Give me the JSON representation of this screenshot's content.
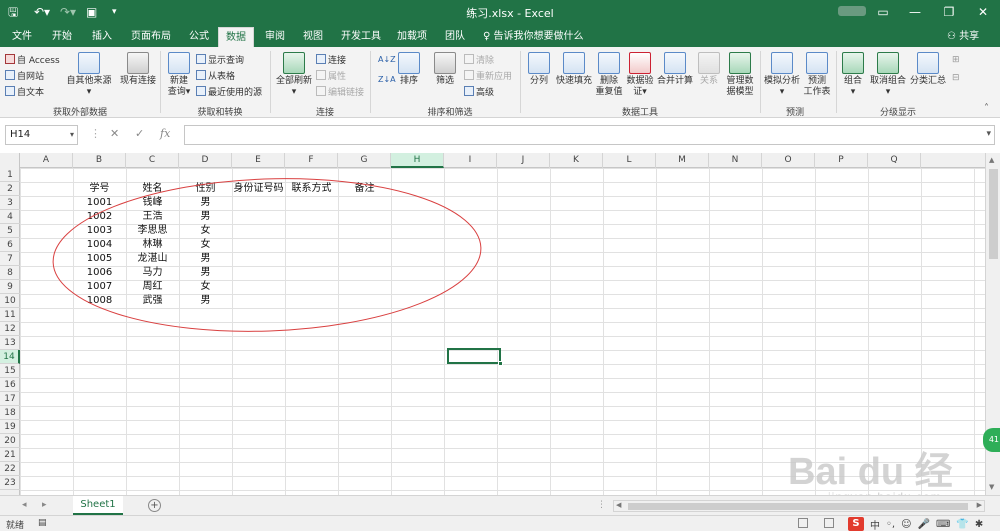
{
  "window": {
    "title": "练习.xlsx - Excel",
    "share_label": "共享",
    "tell_me": "告诉我你想要做什么"
  },
  "tabs": [
    "文件",
    "开始",
    "插入",
    "页面布局",
    "公式",
    "数据",
    "审阅",
    "视图",
    "开发工具",
    "加载项",
    "团队"
  ],
  "active_tab": "数据",
  "ribbon": {
    "get_external": {
      "access": "自 Access",
      "web": "自网站",
      "text": "自文本",
      "other_sources": "自其他来源",
      "existing": "现有连接",
      "group": "获取外部数据"
    },
    "get_transform": {
      "new_query_1": "新建",
      "new_query_2": "查询",
      "show_queries": "显示查询",
      "from_table": "从表格",
      "recent_sources": "最近使用的源",
      "group": "获取和转换"
    },
    "connections": {
      "refresh_all": "全部刷新",
      "connections": "连接",
      "properties": "属性",
      "edit_links": "编辑链接",
      "group": "连接"
    },
    "sort_filter": {
      "sort": "排序",
      "filter": "筛选",
      "clear": "清除",
      "reapply": "重新应用",
      "advanced": "高级",
      "group": "排序和筛选"
    },
    "data_tools": {
      "text_to_columns": "分列",
      "flash_fill": "快速填充",
      "remove_dup_1": "删除",
      "remove_dup_2": "重复值",
      "validation_1": "数据验",
      "validation_2": "证",
      "consolidate": "合并计算",
      "relationships": "关系",
      "manage_model_1": "管理数",
      "manage_model_2": "据模型",
      "group": "数据工具"
    },
    "forecast": {
      "what_if": "模拟分析",
      "forecast_sheet_1": "预测",
      "forecast_sheet_2": "工作表",
      "group": "预测"
    },
    "outline": {
      "group_btn": "组合",
      "ungroup": "取消组合",
      "subtotal": "分类汇总",
      "group": "分级显示"
    }
  },
  "formula_bar": {
    "name_box": "H14",
    "fx": "fx",
    "value": ""
  },
  "columns": [
    "A",
    "B",
    "C",
    "D",
    "E",
    "F",
    "G",
    "H",
    "I",
    "J",
    "K",
    "L",
    "M",
    "N",
    "O",
    "P",
    "Q"
  ],
  "rows": [
    "1",
    "2",
    "3",
    "4",
    "5",
    "6",
    "7",
    "8",
    "9",
    "10",
    "11",
    "12",
    "13",
    "14",
    "15",
    "16",
    "17",
    "18",
    "19",
    "20",
    "21",
    "22",
    "23"
  ],
  "selected_cell": "H14",
  "table": {
    "headers": [
      "学号",
      "姓名",
      "性别",
      "身份证号码",
      "联系方式",
      "备注"
    ],
    "rows": [
      [
        "1001",
        "钱峰",
        "男"
      ],
      [
        "1002",
        "王浩",
        "男"
      ],
      [
        "1003",
        "李思思",
        "女"
      ],
      [
        "1004",
        "林琳",
        "女"
      ],
      [
        "1005",
        "龙湛山",
        "男"
      ],
      [
        "1006",
        "马力",
        "男"
      ],
      [
        "1007",
        "周红",
        "女"
      ],
      [
        "1008",
        "武强",
        "男"
      ]
    ]
  },
  "sheets": [
    "Sheet1"
  ],
  "status": {
    "ready": "就绪",
    "ime_zh": "中"
  },
  "badge": "41",
  "watermark": {
    "line1": "Bai du 经验",
    "line2": "jingyan.baidu.com"
  },
  "colors": {
    "accent": "#217346",
    "ellipse": "#d94040"
  }
}
